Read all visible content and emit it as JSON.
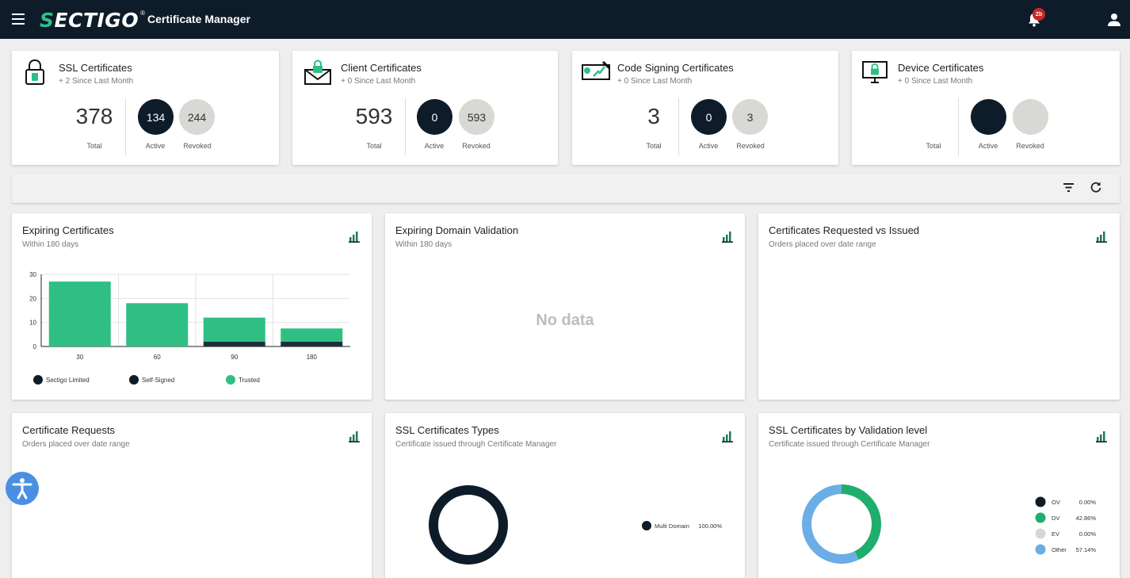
{
  "header": {
    "logo_main": "ECTIGO",
    "logo_s": "S",
    "logo_reg": "®",
    "app_title": "Certificate Manager",
    "notification_badge": "Zb"
  },
  "summary_cards": [
    {
      "title": "SSL Certificates",
      "sub": "+ 2 Since Last Month",
      "total": "378",
      "active": "134",
      "revoked": "244",
      "total_label": "Total",
      "active_label": "Active",
      "revoked_label": "Revoked",
      "icon": "lock-icon"
    },
    {
      "title": "Client Certificates",
      "sub": "+ 0 Since Last Month",
      "total": "593",
      "active": "0",
      "revoked": "593",
      "total_label": "Total",
      "active_label": "Active",
      "revoked_label": "Revoked",
      "icon": "envelope-lock-icon"
    },
    {
      "title": "Code Signing Certificates",
      "sub": "+ 0 Since Last Month",
      "total": "3",
      "active": "0",
      "revoked": "3",
      "total_label": "Total",
      "active_label": "Active",
      "revoked_label": "Revoked",
      "icon": "code-signing-icon"
    },
    {
      "title": "Device Certificates",
      "sub": "+ 0 Since Last Month",
      "total": "",
      "active": "",
      "revoked": "",
      "total_label": "Total",
      "active_label": "Active",
      "revoked_label": "Revoked",
      "icon": "monitor-lock-icon"
    }
  ],
  "widgets": {
    "expiring": {
      "title": "Expiring Certificates",
      "sub": "Within 180 days"
    },
    "domain_validation": {
      "title": "Expiring Domain Validation",
      "sub": "Within 180 days",
      "empty": "No data"
    },
    "requested_vs_issued": {
      "title": "Certificates Requested vs Issued",
      "sub": "Orders placed over date range"
    },
    "requests": {
      "title": "Certificate Requests",
      "sub": "Orders placed over date range"
    },
    "ssl_types": {
      "title": "SSL Certificates Types",
      "sub": "Certificate issued through Certificate Manager"
    },
    "validation_level": {
      "title": "SSL Certificates by Validation level",
      "sub": "Certificate issued through Certificate Manager"
    }
  },
  "colors": {
    "navy": "#0e1c2a",
    "green": "#2fbf84",
    "grey": "#d8d8d4",
    "blue": "#6aaee5"
  },
  "chart_data": [
    {
      "type": "bar",
      "title": "Expiring Certificates",
      "categories": [
        "30",
        "60",
        "90",
        "180"
      ],
      "series": [
        {
          "name": "Sectigo Limited",
          "color": "#0e1c2a",
          "values": [
            0,
            0,
            0,
            0
          ]
        },
        {
          "name": "Self-Signed",
          "color": "#1f2f3a",
          "values": [
            0,
            0,
            2,
            2
          ]
        },
        {
          "name": "Trusted",
          "color": "#2fbf84",
          "values": [
            27,
            18,
            10,
            5.5
          ]
        }
      ],
      "stacked": true,
      "ylim": [
        0,
        30
      ],
      "yticks": [
        "0",
        "10",
        "20",
        "30"
      ],
      "grid": true,
      "legend": "bottom"
    },
    {
      "type": "pie",
      "title": "SSL Certificates Types",
      "labels": [
        "Multi Domain"
      ],
      "values": [
        100
      ],
      "display": [
        "100.00%"
      ],
      "colors": [
        "#0e1c2a"
      ]
    },
    {
      "type": "pie",
      "title": "SSL Certificates by Validation level",
      "labels": [
        "OV",
        "DV",
        "EV",
        "Other"
      ],
      "values": [
        0,
        42.86,
        0,
        57.14
      ],
      "display": [
        "0.00%",
        "42.86%",
        "0.00%",
        "57.14%"
      ],
      "colors": [
        "#0e1c2a",
        "#1fae6d",
        "#d6d6d6",
        "#6aaee5"
      ]
    }
  ]
}
